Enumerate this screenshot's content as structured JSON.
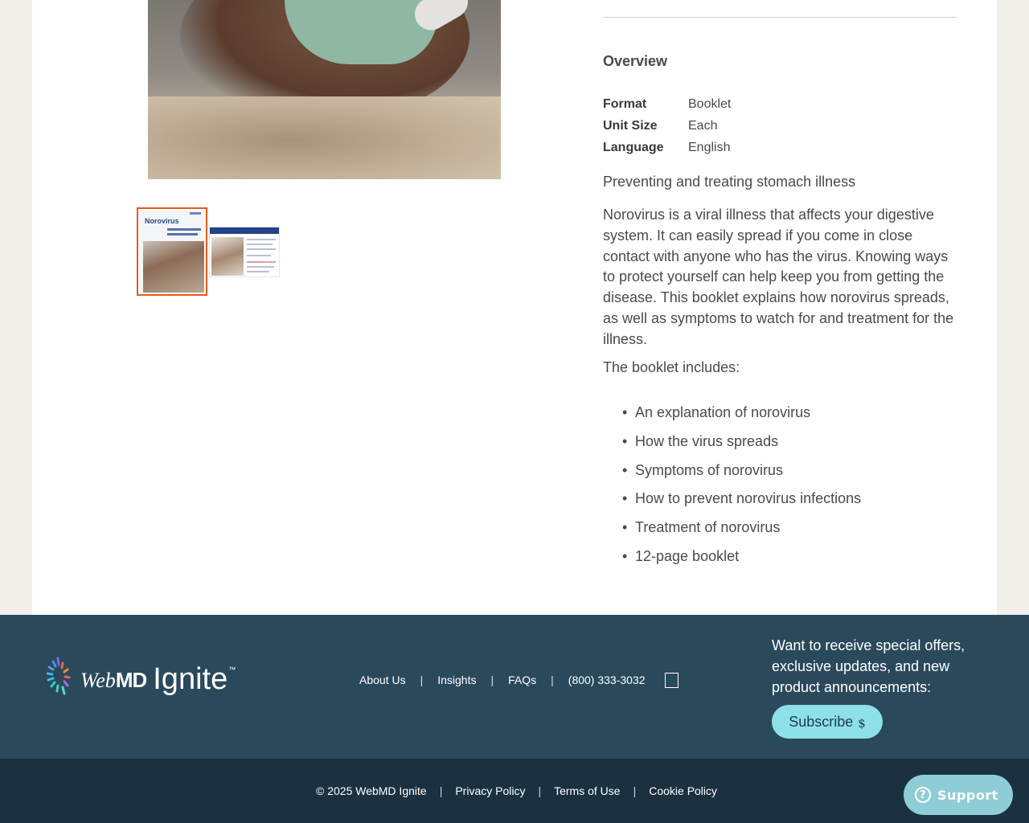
{
  "gallery": {
    "thumbnails": [
      {
        "cover_title": "Norovirus",
        "selected": true
      },
      {
        "selected": false
      }
    ]
  },
  "product": {
    "overview_title": "Overview",
    "specs": [
      {
        "label": "Format",
        "value": "Booklet"
      },
      {
        "label": "Unit Size",
        "value": "Each"
      },
      {
        "label": "Language",
        "value": "English"
      }
    ],
    "subtitle": "Preventing and treating stomach illness",
    "description": "Norovirus is a viral illness that affects your digestive system. It can easily spread if you come in close contact with anyone who has the virus. Knowing ways to protect yourself can help keep you from getting the disease. This booklet explains how norovirus spreads, as well as symptoms to watch for and treatment for the illness.",
    "includes_heading": "The booklet includes:",
    "includes": [
      "An explanation of norovirus",
      "How the virus spreads",
      "Symptoms of norovirus",
      "How to prevent norovirus infections",
      "Treatment of norovirus",
      "12-page booklet"
    ]
  },
  "footer": {
    "logo": {
      "web": "Web",
      "md": "MD",
      "ignite": "Ignite",
      "tm": "™"
    },
    "nav": [
      "About Us",
      "Insights",
      "FAQs",
      "(800) 333-3032"
    ],
    "separator": "|",
    "promo_text": "Want to receive special offers, exclusive updates, and new product announcements:",
    "subscribe_label": "Subscribe",
    "subscribe_icon": "$",
    "copyright": "© 2025 WebMD Ignite",
    "legal_links": [
      "Privacy Policy",
      "Terms of Use",
      "Cookie Policy"
    ]
  },
  "support": {
    "label": "Support",
    "icon": "?"
  },
  "colors": {
    "page_bg": "#f1efea",
    "footer_bg": "#2a4a5c",
    "bottom_bg": "#1b3140",
    "accent_border": "#e8591a",
    "subscribe_bg": "#8ee0e8",
    "support_bg": "#8fcdd6"
  }
}
